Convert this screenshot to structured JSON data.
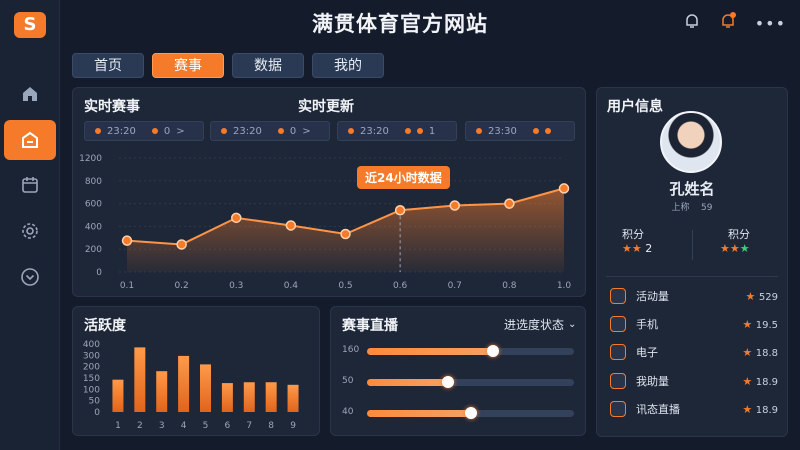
{
  "app": {
    "title": "满贯体育官方网站",
    "logo_letter": "S"
  },
  "tabs": [
    {
      "label": "首页",
      "active": false
    },
    {
      "label": "赛事",
      "active": true
    },
    {
      "label": "数据",
      "active": false
    },
    {
      "label": "我的",
      "active": false
    }
  ],
  "live_panel": {
    "title": "实时赛事",
    "update_title": "实时更新",
    "cards": [
      {
        "time": "23:20",
        "extra": "0",
        "arrow": ">"
      },
      {
        "time": "23:20",
        "extra": "0",
        "arrow": ">"
      },
      {
        "time": "23:20",
        "extra": "1",
        "arrow": ""
      },
      {
        "time": "23:30",
        "extra": "",
        "arrow": ""
      }
    ],
    "tooltip": "近24小时数据",
    "chart_data": {
      "type": "line",
      "x": [
        "0.1",
        "0.2",
        "0.3",
        "0.4",
        "0.5",
        "0.6",
        "0.7",
        "0.8",
        "1.0"
      ],
      "values": [
        330,
        290,
        570,
        490,
        400,
        650,
        700,
        720,
        880
      ],
      "yticks": [
        "1200",
        "800",
        "600",
        "400",
        "200",
        "0"
      ],
      "ylim": [
        0,
        1200
      ],
      "accent": "#f57b2a"
    }
  },
  "activity_panel": {
    "title": "活跃度",
    "chart_data": {
      "type": "bar",
      "categories": [
        "1",
        "2",
        "3",
        "4",
        "5",
        "6",
        "7",
        "8",
        "9"
      ],
      "values": [
        190,
        380,
        240,
        330,
        280,
        170,
        175,
        175,
        160
      ],
      "yticks": [
        "400",
        "300",
        "200",
        "150",
        "100",
        "50",
        "0"
      ],
      "ylim": [
        0,
        400
      ]
    }
  },
  "live_stream_panel": {
    "title": "赛事直播",
    "dropdown": "进选度状态",
    "sliders": [
      {
        "label": "160",
        "fill": 0.61
      },
      {
        "label": "50",
        "fill": 0.39
      },
      {
        "label": "40",
        "fill": 0.5
      }
    ]
  },
  "user_panel": {
    "title": "用户信息",
    "name": "孔姓名",
    "sub_left": "上称",
    "sub_right": "59",
    "points_left_label": "积分",
    "points_left_value": "2",
    "points_right_label": "积分",
    "items": [
      {
        "label": "活动量",
        "value": "529"
      },
      {
        "label": "手机",
        "value": "19.5"
      },
      {
        "label": "电子",
        "value": "18.8"
      },
      {
        "label": "我助量",
        "value": "18.9"
      },
      {
        "label": "讯态直播",
        "value": "18.9"
      }
    ]
  },
  "colors": {
    "accent": "#f57b2a",
    "bg": "#141c2b",
    "panel": "#1d2738"
  }
}
